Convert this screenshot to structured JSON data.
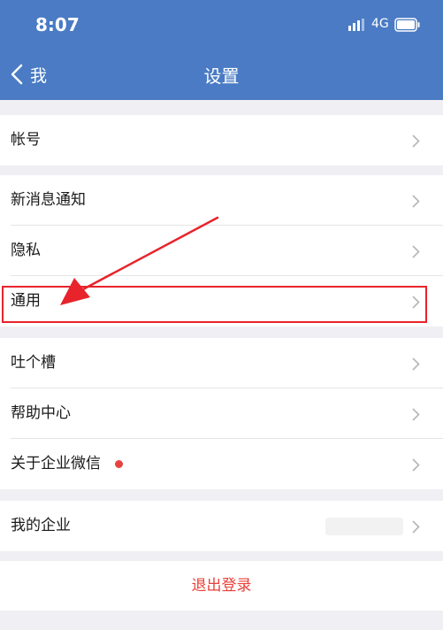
{
  "status_bar": {
    "time": "8:07",
    "network": "4G"
  },
  "nav": {
    "back_label": "我",
    "title": "设置"
  },
  "groups": [
    {
      "items": [
        {
          "label": "帐号"
        }
      ]
    },
    {
      "items": [
        {
          "label": "新消息通知"
        },
        {
          "label": "隐私"
        },
        {
          "label": "通用"
        }
      ]
    },
    {
      "items": [
        {
          "label": "吐个槽"
        },
        {
          "label": "帮助中心"
        },
        {
          "label": "关于企业微信"
        }
      ]
    },
    {
      "items": [
        {
          "label": "我的企业"
        }
      ]
    }
  ],
  "logout_label": "退出登录",
  "colors": {
    "header_bg": "#4a7bc4",
    "page_bg": "#efeff4",
    "logout_text": "#e8413a",
    "badge_dot": "#e64340",
    "annotation": "#e8232b"
  }
}
